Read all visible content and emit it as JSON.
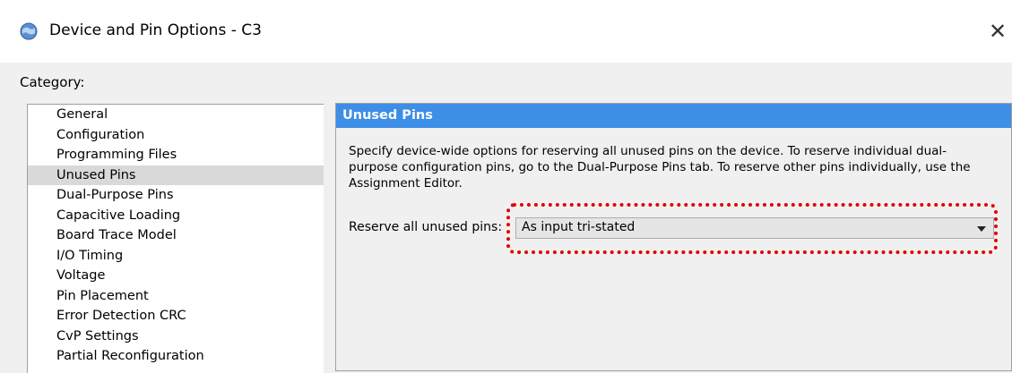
{
  "window": {
    "title": "Device and Pin Options - C3",
    "close_glyph": "✕"
  },
  "category": {
    "label": "Category:",
    "items": [
      "General",
      "Configuration",
      "Programming Files",
      "Unused Pins",
      "Dual-Purpose Pins",
      "Capacitive Loading",
      "Board Trace Model",
      "I/O Timing",
      "Voltage",
      "Pin Placement",
      "Error Detection CRC",
      "CvP Settings",
      "Partial Reconfiguration"
    ],
    "selected": "Unused Pins"
  },
  "panel": {
    "header": "Unused Pins",
    "description": "Specify device-wide options for reserving all unused pins on the device. To reserve individual dual-purpose configuration pins, go to the Dual-Purpose Pins tab. To reserve other pins individually, use the Assignment Editor.",
    "reserve_label": "Reserve all unused pins:",
    "reserve_value": "As input tri-stated"
  },
  "colors": {
    "header_bg": "#3d8ee6",
    "highlight": "#e00000",
    "selected_bg": "#d9d9d9"
  }
}
